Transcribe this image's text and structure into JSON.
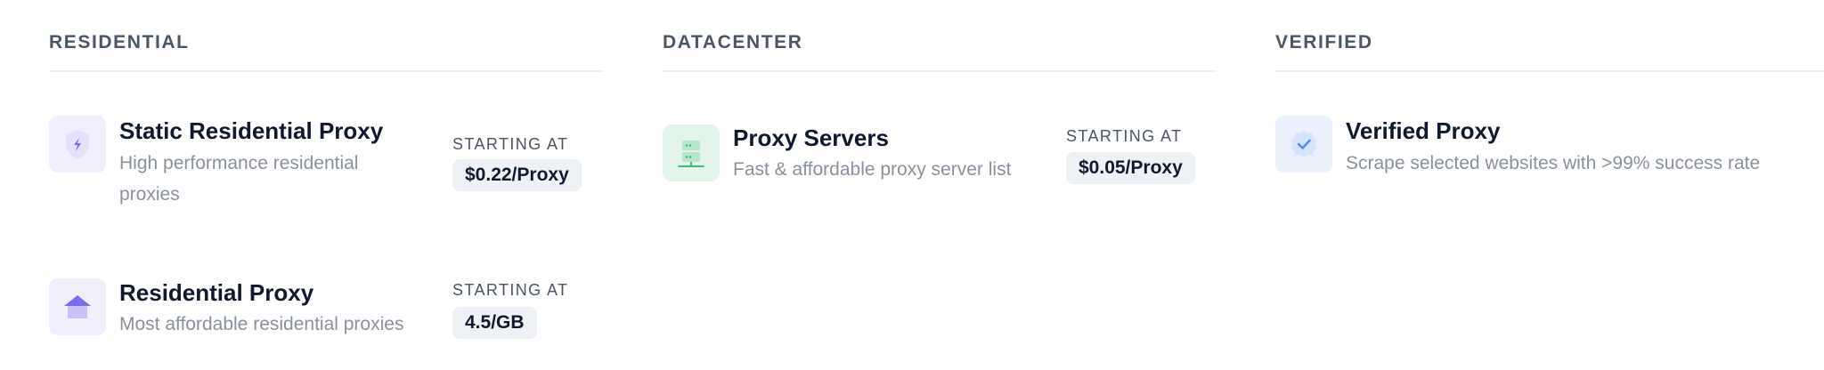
{
  "sections": [
    {
      "title": "RESIDENTIAL",
      "products": [
        {
          "name": "Static Residential Proxy",
          "description": "High performance residential proxies",
          "starting_label": "STARTING AT",
          "price": "$0.22/Proxy",
          "icon": "shield-bolt-icon"
        },
        {
          "name": "Residential Proxy",
          "description": "Most affordable residential proxies",
          "starting_label": "STARTING AT",
          "price": "4.5/GB",
          "icon": "home-icon"
        }
      ]
    },
    {
      "title": "DATACENTER",
      "products": [
        {
          "name": "Proxy Servers",
          "description": "Fast & affordable proxy server list",
          "starting_label": "STARTING AT",
          "price": "$0.05/Proxy",
          "icon": "server-icon"
        }
      ]
    },
    {
      "title": "VERIFIED",
      "products": [
        {
          "name": "Verified Proxy",
          "description": "Scrape selected websites with >99% success rate",
          "icon": "verified-badge-icon"
        }
      ]
    }
  ],
  "colors": {
    "residential_icon_bg": "#f1effd",
    "residential_icon_fg": "#7c6cf0",
    "datacenter_icon_bg": "#e3f5ea",
    "datacenter_icon_fg": "#3fbf74",
    "verified_icon_bg": "#eaf1fc",
    "verified_icon_fg": "#4f8ff0",
    "price_pill_bg": "#eef1f5"
  }
}
